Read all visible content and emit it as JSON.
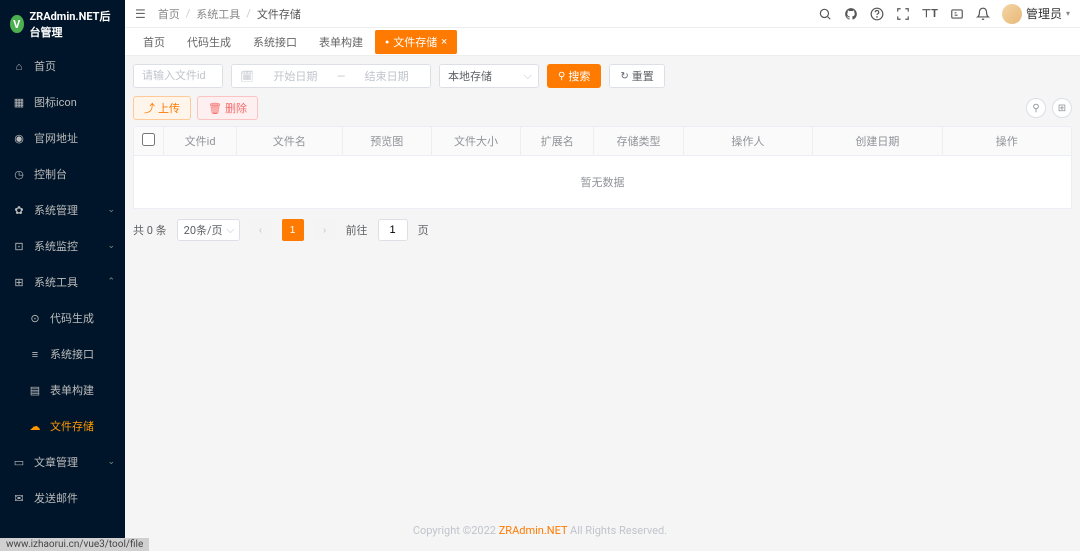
{
  "app": {
    "title": "ZRAdmin.NET后台管理",
    "logo_letter": "V"
  },
  "sidebar": {
    "items": [
      {
        "icon": "home",
        "label": "首页"
      },
      {
        "icon": "grid",
        "label": "图标icon"
      },
      {
        "icon": "globe",
        "label": "官网地址"
      },
      {
        "icon": "dashboard",
        "label": "控制台"
      },
      {
        "icon": "gear",
        "label": "系统管理",
        "expandable": true
      },
      {
        "icon": "monitor",
        "label": "系统监控",
        "expandable": true
      },
      {
        "icon": "tool",
        "label": "系统工具",
        "expandable": true,
        "expanded": true
      },
      {
        "icon": "code",
        "label": "代码生成",
        "sub": true
      },
      {
        "icon": "api",
        "label": "系统接口",
        "sub": true
      },
      {
        "icon": "form",
        "label": "表单构建",
        "sub": true
      },
      {
        "icon": "cloud",
        "label": "文件存储",
        "sub": true,
        "active": true
      },
      {
        "icon": "doc",
        "label": "文章管理",
        "expandable": true
      },
      {
        "icon": "mail",
        "label": "发送邮件"
      }
    ]
  },
  "header": {
    "breadcrumb": [
      "首页",
      "系统工具",
      "文件存储"
    ],
    "user": "管理员"
  },
  "tabs": [
    {
      "label": "首页"
    },
    {
      "label": "代码生成"
    },
    {
      "label": "系统接口"
    },
    {
      "label": "表单构建"
    },
    {
      "label": "文件存储",
      "active": true,
      "closable": true
    }
  ],
  "filters": {
    "fileid_placeholder": "请输入文件id",
    "date_start": "开始日期",
    "date_sep": "—",
    "date_end": "结束日期",
    "storage_select": "本地存储",
    "search_btn": "搜索",
    "reset_btn": "重置"
  },
  "actions": {
    "upload_btn": "上传",
    "delete_btn": "删除"
  },
  "table": {
    "columns": [
      "文件id",
      "文件名",
      "预览图",
      "文件大小",
      "扩展名",
      "存储类型",
      "操作人",
      "创建日期",
      "操作"
    ],
    "empty_text": "暂无数据"
  },
  "pagination": {
    "total_prefix": "共",
    "total_count": "0",
    "total_suffix": "条",
    "page_size": "20条/页",
    "current_page": "1",
    "goto_label": "前往",
    "goto_value": "1",
    "goto_suffix": "页"
  },
  "footer": {
    "copyright_prefix": "Copyright ©2022 ",
    "brand": "ZRAdmin.NET",
    "copyright_suffix": " All Rights Reserved."
  },
  "status_url": "www.izhaorui.cn/vue3/tool/file"
}
